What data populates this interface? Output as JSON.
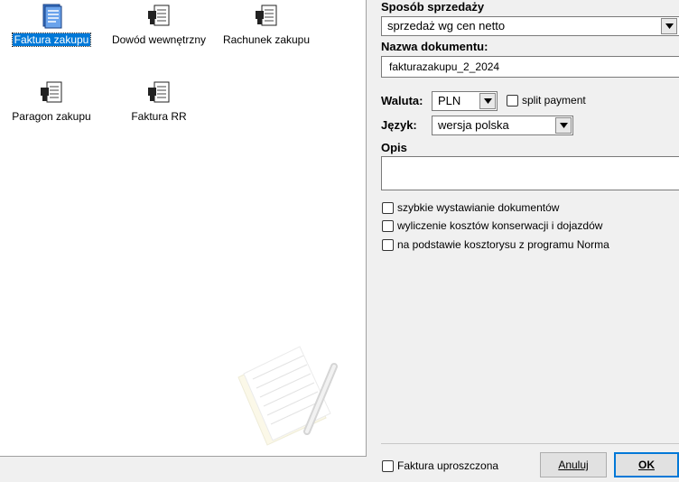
{
  "documents": [
    {
      "label": "Faktura zakupu",
      "selected": true,
      "icon": "invoice-blue-icon"
    },
    {
      "label": "Dowód wewnętrzny",
      "selected": false,
      "icon": "document-stamp-icon"
    },
    {
      "label": "Rachunek zakupu",
      "selected": false,
      "icon": "document-stamp-icon"
    },
    {
      "label": "Paragon zakupu",
      "selected": false,
      "icon": "document-stamp-icon"
    },
    {
      "label": "Faktura RR",
      "selected": false,
      "icon": "document-stamp-icon"
    }
  ],
  "form": {
    "sale_method_label": "Sposób sprzedaży",
    "sale_method_value": "sprzedaż wg cen netto",
    "doc_name_label": "Nazwa dokumentu:",
    "doc_name_value": "fakturazakupu_2_2024",
    "currency_label": "Waluta:",
    "currency_value": "PLN",
    "split_payment_label": "split payment",
    "split_payment_checked": false,
    "language_label": "Język:",
    "language_value": "wersja polska",
    "description_label": "Opis",
    "description_value": "",
    "options": [
      {
        "label": "szybkie wystawianie dokumentów",
        "checked": false
      },
      {
        "label": "wyliczenie kosztów konserwacji i dojazdów",
        "checked": false
      },
      {
        "label": "na podstawie kosztorysu z programu Norma",
        "checked": false
      }
    ]
  },
  "footer": {
    "simplified_invoice_label": "Faktura uproszczona",
    "simplified_invoice_checked": false,
    "cancel_label": "Anuluj",
    "ok_label": "OK"
  },
  "colors": {
    "selection": "#0078d7",
    "panel": "#ffffff",
    "window": "#f0f0f0"
  }
}
